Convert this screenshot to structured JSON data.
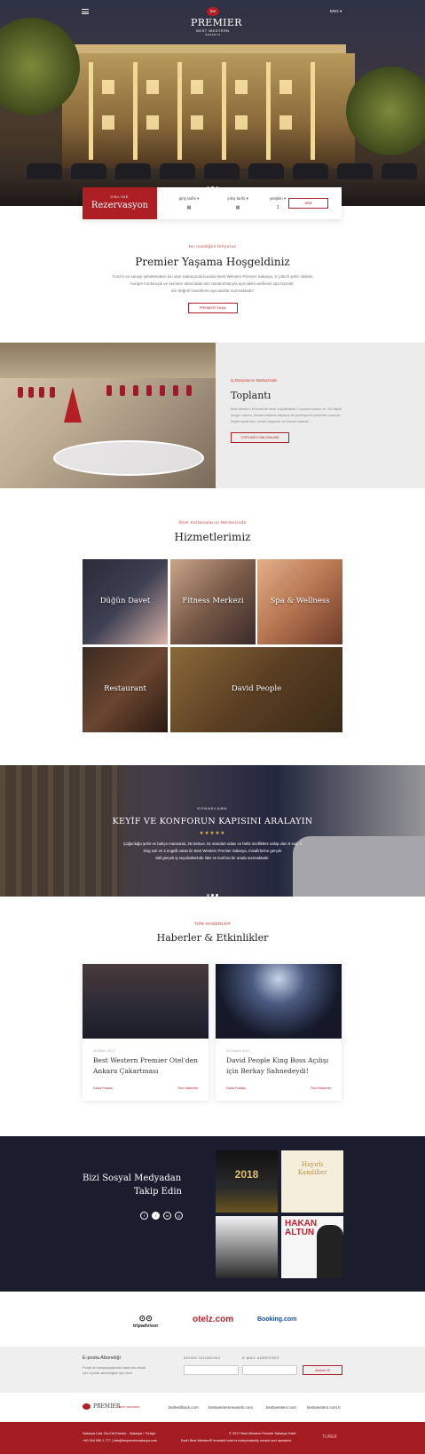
{
  "header": {
    "logo_badge": "BW",
    "logo_name": "PREMIER",
    "logo_sub": "BEST WESTERN",
    "logo_sub2": "SAKARYA",
    "language": "ENG ▾"
  },
  "reservation": {
    "kicker": "ONLINE",
    "title": "Rezervasyon",
    "checkin_label": "giriş tarihi ▾",
    "checkout_label": "çıkış tarihi ▾",
    "guests_label": "yetişkin ▾",
    "guests_value": "2",
    "search_button": "ARA"
  },
  "welcome": {
    "kicker": "Ne istediğini biliyoruz",
    "title": "Premier Yaşama Hoşgeldiniz",
    "text1": "Turizm ve sanayi şehirlerinden biri olan Sakarya'da kurulan Best Western Premier Sakarya, 5 yıldızlı şehir otelinin",
    "text2": "kongre konforuyla ve seminer alanındaki tüm donanımlarıyla ayrıcalıklı wellness spa hizmeti,",
    "text3": "sizi değerli hissettiren ayrıcalıklar sunmaktadır!",
    "button": "PREMIER YAŞA"
  },
  "meeting": {
    "kicker": "İş Dünyasının Merkezinde",
    "title": "Toplantı",
    "text1": "Best Western Premier'de farklı büyüklükteki 9 toplantı salonu ve 700 kişilik",
    "text2": "kongre salonu, donanım/teknik altyapısı ile profesyonel çözümler sunuyor.",
    "text3": "Keyifli toplantılar, sürekli başarılar ve önemli kararlar...",
    "button": "TOPLANTI SALONLARI"
  },
  "services": {
    "kicker": "Özel Kutlamalarını Merkezinde",
    "title": "Hizmetlerimiz",
    "items": [
      "Düğün Davet",
      "Fitness Merkezi",
      "Spa & Wellness",
      "Restaurant",
      "David People"
    ]
  },
  "banner": {
    "kicker": "KONAKLAMA",
    "title": "KEYİF VE KONFORUN KAPISINI ARALAYIN",
    "stars": "★★★★★",
    "text1": "Çoğunluğu şehir ve bahçe manzaralı, 26 Deluxe, 61 standart odası ve farklı özelliklere sahip olan 6 suit, 3",
    "text2": "king suit ve 2 engelli odası ile Best Western Premier Sakarya, misafirlerine gerçek",
    "text3": "tatil gerçek iş seyahatlerinde lüks ve konfora bir arada sunmaktadır."
  },
  "news": {
    "kicker": "TÜM HABERLER",
    "title": "Haberler & Etkinlikler",
    "items": [
      {
        "date": "15 Ekim 2017",
        "title": "Best Western Premier Otel'den Ankara Çakartması",
        "more": "Daha Fazlası",
        "tag": "Tüm Haberler"
      },
      {
        "date": "23 Kasım 2017",
        "title": "David People King Boss Açılışı için Berkay Sahnedeydi!",
        "more": "Daha Fazlası",
        "tag": "Tüm Haberler"
      }
    ]
  },
  "social": {
    "title1": "Bizi Sosyal Medyadan",
    "title2": "Takip Edin",
    "icons": [
      "f",
      "t",
      "in",
      "g"
    ],
    "post1": "2018",
    "post2": "Hayırlı Kandiller",
    "post4_line1": "HAKAN",
    "post4_line2": "ALTUN"
  },
  "partners": [
    "tripadvisor",
    "otelz.com",
    "Booking.com"
  ],
  "newsletter": {
    "title": "E-posta Aboneliği",
    "text1": "Fırsat ve kampanyalardan haberdar olmak",
    "text2": "için e-posta aboneliğine üye olun!",
    "name_label": "ADINIZ SOYADINIZ",
    "email_label": "E-MAIL ADRESİNİZ",
    "button": "Abone Ol"
  },
  "footer": {
    "brand": "PREMIER",
    "brand_sub": "BEST WESTERN",
    "links": [
      "bwfeedback.com",
      "bestwesternrewards.com",
      "bestwestern.com",
      "bestwestern.com.tr"
    ],
    "address": "Sakarya Cad. No:218 Erenler - Sakarya / Türkiye",
    "contact": "+90 264 999 1 777 | info@bwpremiersakarya.com",
    "copyright": "© 2017 Best Western Premier Sakarya Hotel.",
    "disclaimer": "Each Best Western® branded hotel is independently owned and operated.",
    "credit": "TUREK"
  }
}
